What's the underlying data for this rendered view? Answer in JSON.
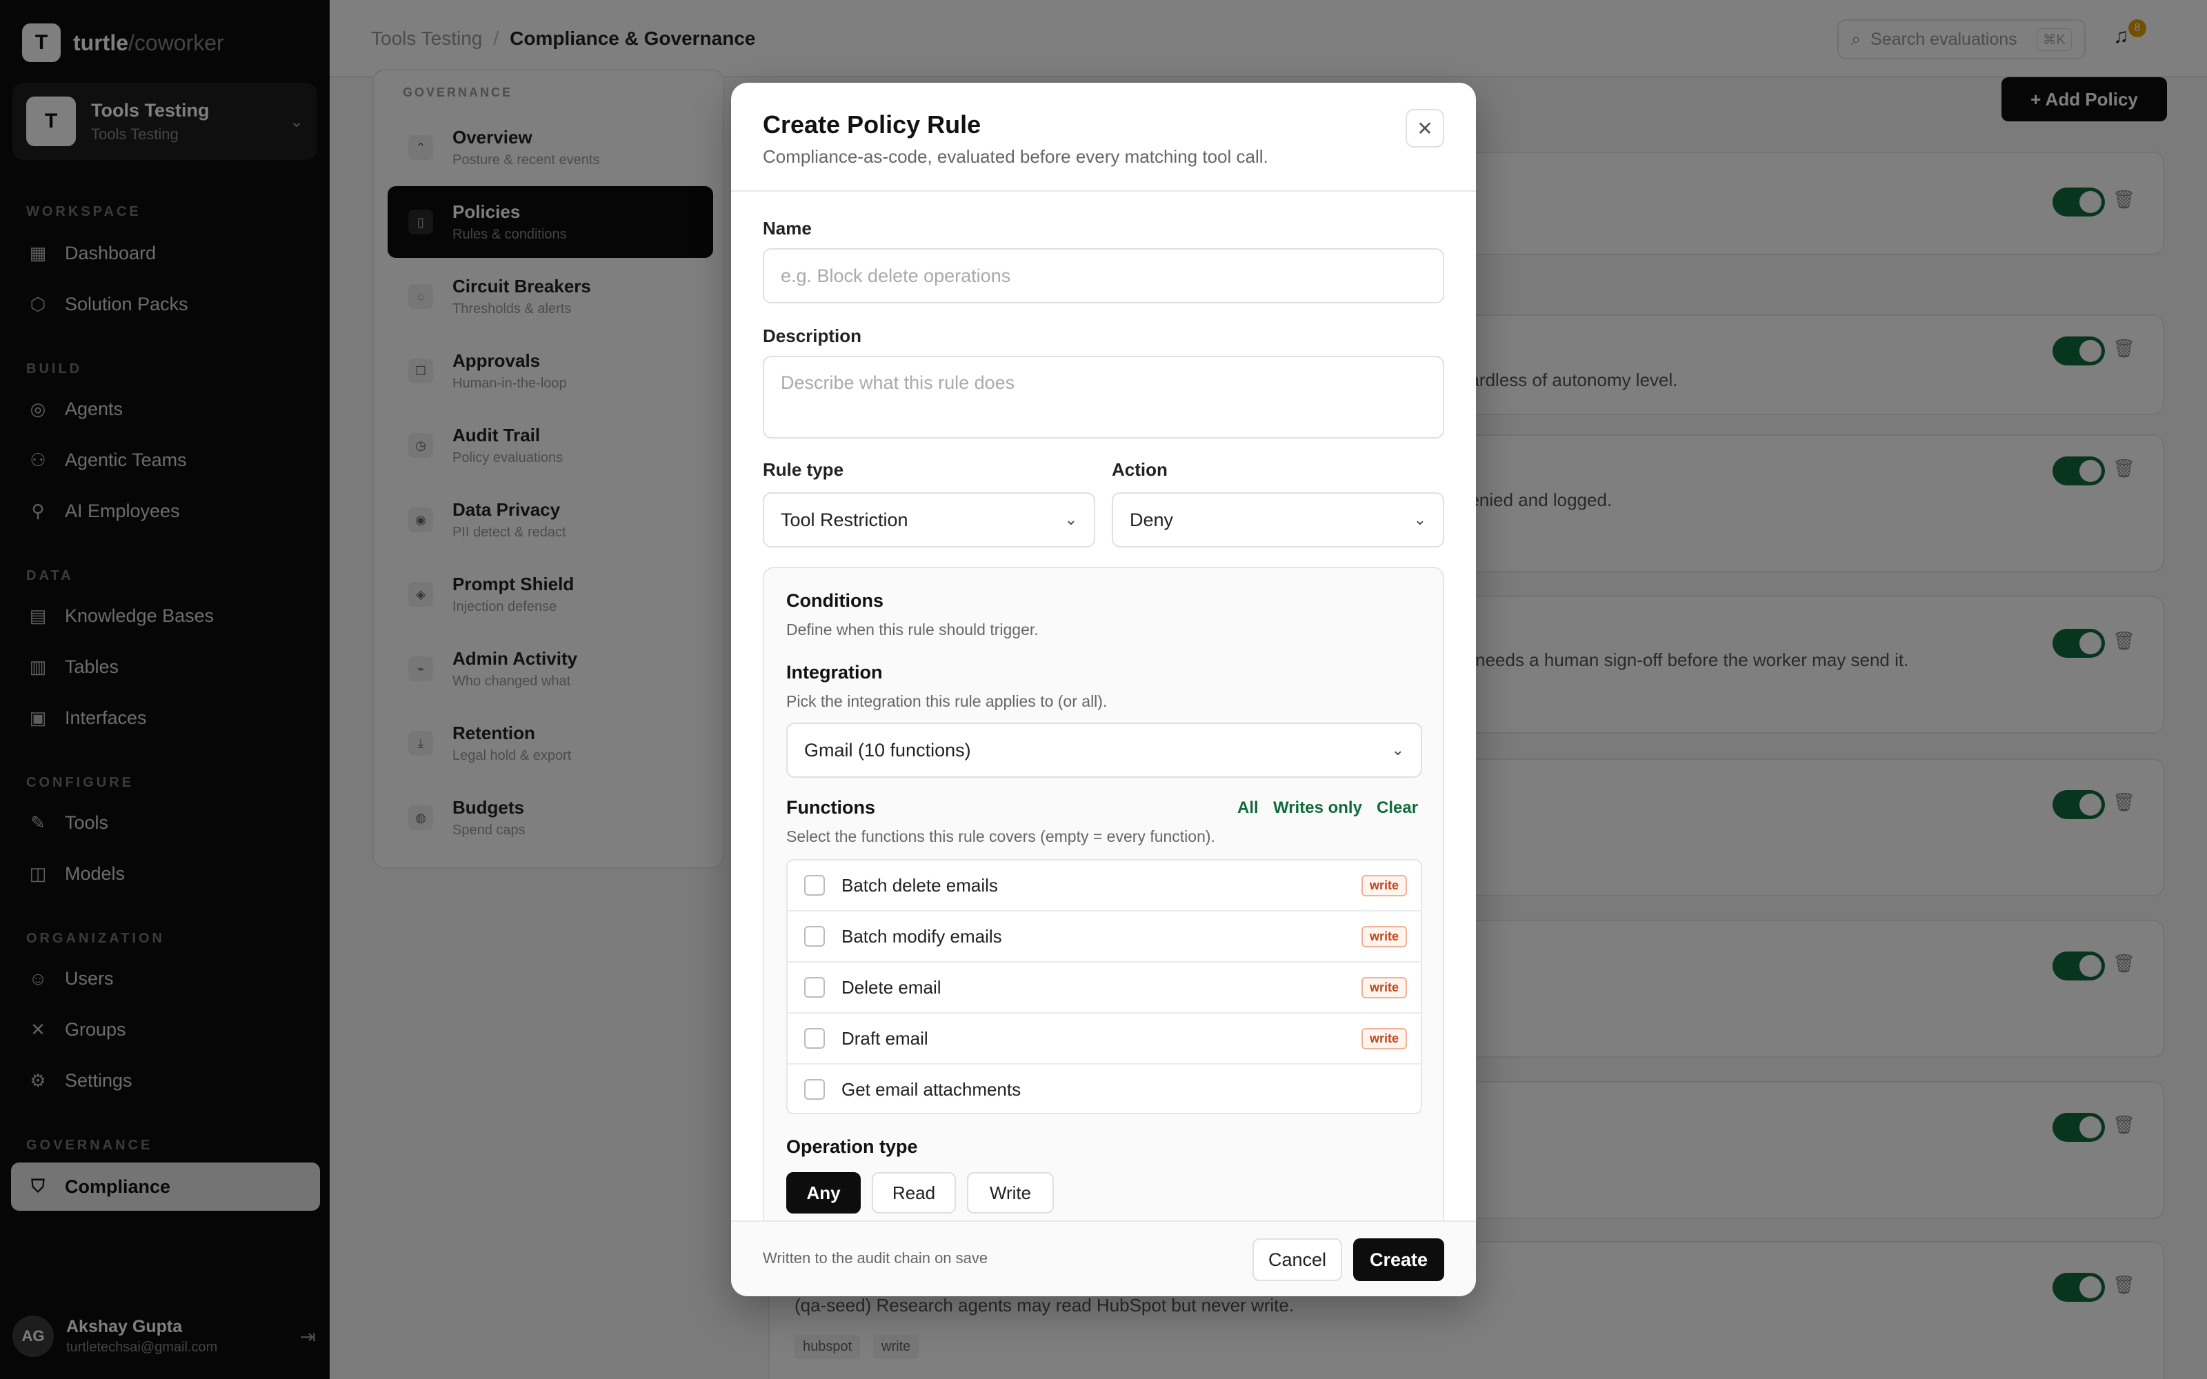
{
  "brand": {
    "logo": "T",
    "name": "turtle",
    "suffix": "/coworker"
  },
  "workspace": {
    "avatar": "T",
    "title": "Tools Testing",
    "subtitle": "Tools Testing",
    "chevron": "chevron-down-icon"
  },
  "sidebar": {
    "sections": [
      "WORKSPACE",
      "BUILD",
      "DATA",
      "CONFIGURE",
      "ORGANIZATION",
      "GOVERNANCE"
    ],
    "items": [
      {
        "label": "Dashboard",
        "icon": "grid-icon"
      },
      {
        "label": "Solution Packs",
        "icon": "package-icon"
      },
      {
        "label": "Agents",
        "icon": "agent-icon"
      },
      {
        "label": "Agentic Teams",
        "icon": "team-icon"
      },
      {
        "label": "AI Employees",
        "icon": "employee-icon"
      },
      {
        "label": "Knowledge Bases",
        "icon": "book-icon"
      },
      {
        "label": "Tables",
        "icon": "table-icon"
      },
      {
        "label": "Interfaces",
        "icon": "interface-icon"
      },
      {
        "label": "Tools",
        "icon": "wrench-icon"
      },
      {
        "label": "Models",
        "icon": "model-icon"
      },
      {
        "label": "Users",
        "icon": "user-icon"
      },
      {
        "label": "Groups",
        "icon": "groups-icon"
      },
      {
        "label": "Settings",
        "icon": "gear-icon"
      },
      {
        "label": "Compliance",
        "icon": "shield-icon"
      }
    ],
    "active": "Compliance"
  },
  "user": {
    "initials": "AG",
    "name": "Akshay Gupta",
    "email": "turtletechsai@gmail.com"
  },
  "breadcrumb": {
    "parent": "Tools Testing",
    "separator": "/",
    "current": "Compliance & Governance"
  },
  "search": {
    "placeholder": "Search evaluations",
    "shortcut": "⌘K"
  },
  "notifications": {
    "count": "8"
  },
  "subnav": {
    "heading": "GOVERNANCE",
    "items": [
      {
        "title": "Overview",
        "desc": "Posture & recent events"
      },
      {
        "title": "Policies",
        "desc": "Rules & conditions"
      },
      {
        "title": "Circuit Breakers",
        "desc": "Thresholds & alerts"
      },
      {
        "title": "Approvals",
        "desc": "Human-in-the-loop"
      },
      {
        "title": "Audit Trail",
        "desc": "Policy evaluations"
      },
      {
        "title": "Data Privacy",
        "desc": "PII detect & redact"
      },
      {
        "title": "Prompt Shield",
        "desc": "Injection defense"
      },
      {
        "title": "Admin Activity",
        "desc": "Who changed what"
      },
      {
        "title": "Retention",
        "desc": "Legal hold & export"
      },
      {
        "title": "Budgets",
        "desc": "Spend caps"
      }
    ],
    "active": "Policies"
  },
  "add_policy": {
    "label": "+ Add Policy"
  },
  "policy_cards": {
    "card2_text": "gardless of autonomy level.",
    "card3_text": "denied and logged.",
    "card4_text": "t) needs a human sign-off before the worker may send it.",
    "card9_text": "(qa-seed) Research agents may read HubSpot but never write.",
    "card9_tags": [
      "hubspot",
      "write"
    ]
  },
  "modal": {
    "title": "Create Policy Rule",
    "subtitle": "Compliance-as-code, evaluated before every matching tool call.",
    "close_icon": "close-icon",
    "name": {
      "label": "Name",
      "placeholder": "e.g. Block delete operations",
      "value": ""
    },
    "description": {
      "label": "Description",
      "placeholder": "Describe what this rule does",
      "value": ""
    },
    "rule_type": {
      "label": "Rule type",
      "value": "Tool Restriction"
    },
    "action": {
      "label": "Action",
      "value": "Deny"
    },
    "conditions": {
      "title": "Conditions",
      "desc": "Define when this rule should trigger.",
      "integration": {
        "label": "Integration",
        "desc": "Pick the integration this rule applies to (or all).",
        "value": "Gmail (10 functions)"
      },
      "functions": {
        "label": "Functions",
        "desc": "Select the functions this rule covers (empty = every function).",
        "links": {
          "all": "All",
          "writes_only": "Writes only",
          "clear": "Clear"
        },
        "items": [
          {
            "label": "Batch delete emails",
            "tag": "write",
            "checked": false
          },
          {
            "label": "Batch modify emails",
            "tag": "write",
            "checked": false
          },
          {
            "label": "Delete email",
            "tag": "write",
            "checked": false
          },
          {
            "label": "Draft email",
            "tag": "write",
            "checked": false
          },
          {
            "label": "Get email attachments",
            "tag": "",
            "checked": false
          }
        ]
      },
      "operation_type": {
        "label": "Operation type",
        "options": [
          "Any",
          "Read",
          "Write"
        ],
        "selected": "Any"
      }
    },
    "footer": {
      "note": "Written to the audit chain on save",
      "cancel": "Cancel",
      "create": "Create"
    }
  },
  "colors": {
    "accent": "#0f6b3d",
    "write_tag": "#c4481b",
    "dark": "#0d0d0d"
  }
}
